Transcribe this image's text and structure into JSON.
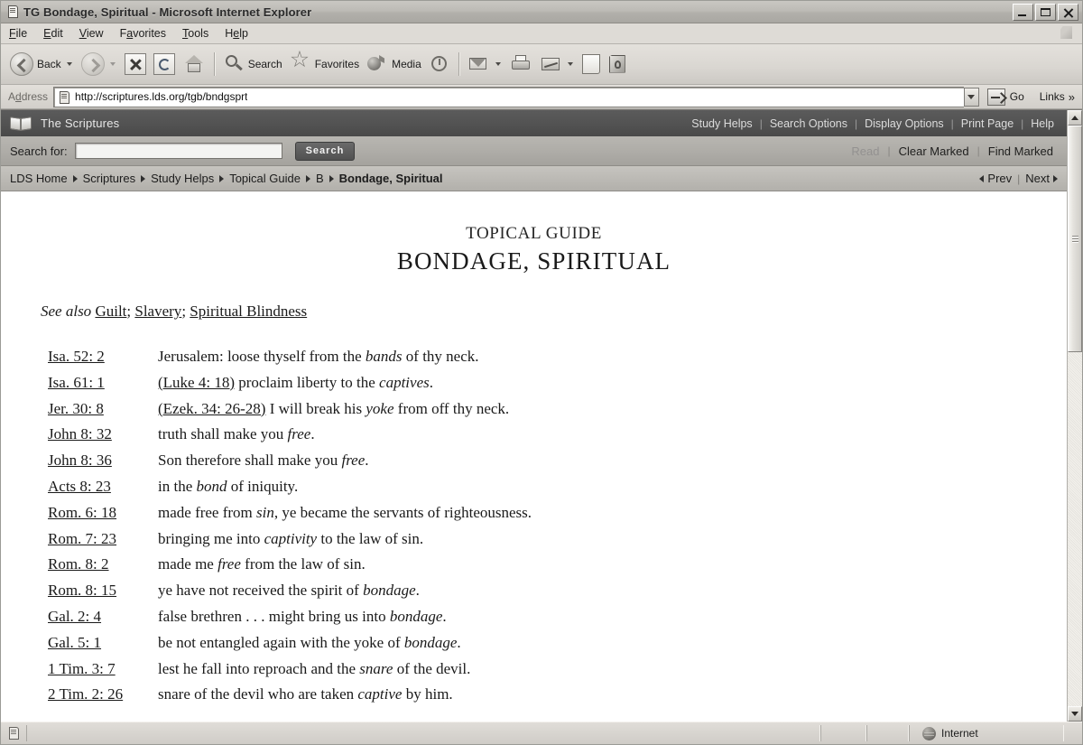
{
  "window": {
    "title": "TG Bondage, Spiritual - Microsoft Internet Explorer",
    "icon": "page-icon",
    "minimize_label": "Minimize",
    "maximize_label": "Maximize",
    "close_label": "Close"
  },
  "menu": {
    "items": [
      "File",
      "Edit",
      "View",
      "Favorites",
      "Tools",
      "Help"
    ]
  },
  "toolbar": {
    "back_label": "Back",
    "forward_label": "Forward",
    "stop_label": "Stop",
    "refresh_label": "Refresh",
    "home_label": "Home",
    "search_label": "Search",
    "favorites_label": "Favorites",
    "media_label": "Media",
    "history_label": "History",
    "mail_label": "Mail",
    "print_label": "Print",
    "edit_label": "Edit",
    "discuss_label": "Discuss",
    "messenger_label": "Messenger"
  },
  "address": {
    "label": "Address",
    "url": "http://scriptures.lds.org/tgb/bndgsprt",
    "go_label": "Go",
    "links_label": "Links",
    "overflow_glyph": "»"
  },
  "site_header": {
    "title": "The Scriptures",
    "icon": "book-icon",
    "links": [
      "Study Helps",
      "Search Options",
      "Display Options",
      "Print Page",
      "Help"
    ],
    "divider": "|"
  },
  "search_bar": {
    "label": "Search for:",
    "value": "",
    "placeholder": "",
    "button_label": "Search",
    "read_label": "Read",
    "read_disabled": true,
    "clear_marked_label": "Clear Marked",
    "find_marked_label": "Find Marked",
    "divider": "|"
  },
  "breadcrumb": {
    "items": [
      {
        "label": "LDS Home",
        "current": false
      },
      {
        "label": "Scriptures",
        "current": false
      },
      {
        "label": "Study Helps",
        "current": false
      },
      {
        "label": "Topical Guide",
        "current": false
      },
      {
        "label": "B",
        "current": false
      },
      {
        "label": "Bondage, Spiritual",
        "current": true
      }
    ],
    "prev_label": "Prev",
    "next_label": "Next",
    "divider": "|"
  },
  "document": {
    "kicker": "TOPICAL GUIDE",
    "title": "BONDAGE, SPIRITUAL",
    "see_also_label": "See also",
    "see_also_links": [
      "Guilt",
      "Slavery",
      "Spiritual Blindness"
    ],
    "see_also_separator": ";",
    "entries": [
      {
        "ref": "Isa. 52: 2",
        "xref": "",
        "text": "Jerusalem: loose thyself from the ",
        "em": "bands",
        "tail": " of thy neck."
      },
      {
        "ref": "Isa. 61: 1",
        "xref": "(Luke 4: 18)",
        "text": " proclaim liberty to the ",
        "em": "captives",
        "tail": "."
      },
      {
        "ref": "Jer. 30: 8",
        "xref": "(Ezek. 34: 26-28)",
        "text": " I will break his ",
        "em": "yoke",
        "tail": " from off thy neck."
      },
      {
        "ref": "John 8: 32",
        "xref": "",
        "text": "truth shall make you ",
        "em": "free",
        "tail": "."
      },
      {
        "ref": "John 8: 36",
        "xref": "",
        "text": "Son therefore shall make you ",
        "em": "free",
        "tail": "."
      },
      {
        "ref": "Acts 8: 23",
        "xref": "",
        "text": "in the ",
        "em": "bond",
        "tail": " of iniquity."
      },
      {
        "ref": "Rom. 6: 18",
        "xref": "",
        "text": "made free from ",
        "em": "sin",
        "tail": ", ye became the servants of righteousness."
      },
      {
        "ref": "Rom. 7: 23",
        "xref": "",
        "text": "bringing me into ",
        "em": "captivity",
        "tail": " to the law of sin."
      },
      {
        "ref": "Rom. 8: 2",
        "xref": "",
        "text": "made me ",
        "em": "free",
        "tail": " from the law of sin."
      },
      {
        "ref": "Rom. 8: 15",
        "xref": "",
        "text": "ye have not received the spirit of ",
        "em": "bondage",
        "tail": "."
      },
      {
        "ref": "Gal. 2: 4",
        "xref": "",
        "text": "false brethren . . . might bring us into ",
        "em": "bondage",
        "tail": "."
      },
      {
        "ref": "Gal. 5: 1",
        "xref": "",
        "text": "be not entangled again with the yoke of ",
        "em": "bondage",
        "tail": "."
      },
      {
        "ref": "1 Tim. 3: 7",
        "xref": "",
        "text": "lest he fall into reproach and the ",
        "em": "snare",
        "tail": " of the devil."
      },
      {
        "ref": "2 Tim. 2: 26",
        "xref": "",
        "text": "snare of the devil who are taken ",
        "em": "captive",
        "tail": " by him."
      }
    ]
  },
  "status_bar": {
    "message": "",
    "zone_label": "Internet",
    "zone_icon": "globe-icon"
  }
}
